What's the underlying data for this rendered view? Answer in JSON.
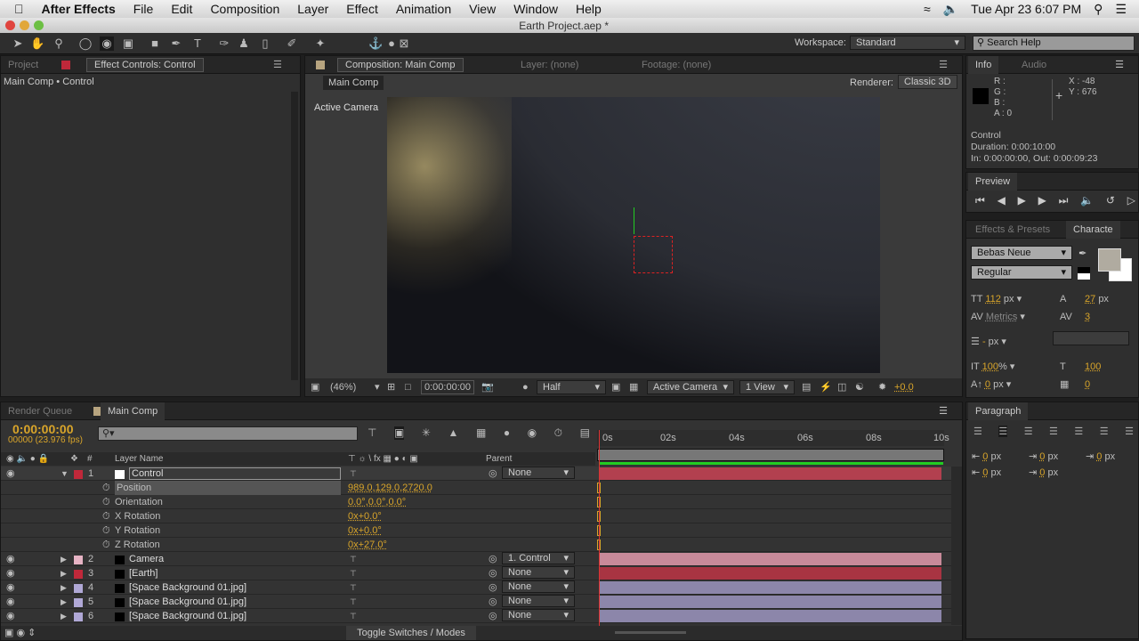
{
  "menubar": {
    "app": "After Effects",
    "items": [
      "File",
      "Edit",
      "Composition",
      "Layer",
      "Effect",
      "Animation",
      "View",
      "Window",
      "Help"
    ],
    "clock": "Tue Apr 23  6:07 PM"
  },
  "window": {
    "title": "Earth Project.aep *"
  },
  "toolbar": {
    "workspace_label": "Workspace:",
    "workspace": "Standard",
    "search_placeholder": "Search Help"
  },
  "left_panel": {
    "tabs": [
      "Project",
      "Effect Controls: Control"
    ],
    "breadcrumb": "Main Comp • Control"
  },
  "comp_panel": {
    "tabs": [
      "Composition: Main Comp",
      "Layer: (none)",
      "Footage: (none)"
    ],
    "comp_button": "Main Comp",
    "renderer_label": "Renderer:",
    "renderer": "Classic 3D",
    "camera_label": "Active Camera",
    "footer": {
      "zoom": "(46%)",
      "timecode": "0:00:00:00",
      "resolution": "Half",
      "camera": "Active Camera",
      "views": "1 View",
      "exposure": "+0.0"
    }
  },
  "info": {
    "tabs": [
      "Info",
      "Audio"
    ],
    "r": "R :",
    "g": "G :",
    "b": "B :",
    "a": "A : 0",
    "x": "X : -48",
    "y": "Y : 676",
    "layer": "Control",
    "duration": "Duration: 0:00:10:00",
    "inout": "In: 0:00:00:00, Out: 0:00:09:23"
  },
  "preview": {
    "tab": "Preview"
  },
  "character": {
    "tabs": [
      "Effects & Presets",
      "Characte"
    ],
    "font": "Bebas Neue",
    "style": "Regular",
    "size": "112",
    "size_unit": "px",
    "leading": "27",
    "leading_unit": "px",
    "kerning": "Metrics",
    "tracking": "3",
    "stroke": "-",
    "stroke_unit": "px",
    "vscale": "100",
    "hscale": "100",
    "pct": "%",
    "baseline": "0",
    "baseline_unit": "px",
    "tsume": "0"
  },
  "paragraph": {
    "tab": "Paragraph",
    "values": [
      "0",
      "0",
      "0",
      "0",
      "0"
    ],
    "unit": "px"
  },
  "timeline": {
    "tabs": [
      "Render Queue",
      "Main Comp"
    ],
    "timecode": "0:00:00:00",
    "frames": "00000 (23.976 fps)",
    "col_layer_name": "Layer Name",
    "col_num": "#",
    "col_parent": "Parent",
    "ruler": [
      "0s",
      "02s",
      "04s",
      "06s",
      "08s",
      "10s"
    ],
    "toggle_label": "Toggle Switches / Modes",
    "layers": [
      {
        "num": "1",
        "name": "Control",
        "color": "#c0283a",
        "parent": "None",
        "bar": "#b2404f"
      },
      {
        "num": "2",
        "name": "Camera",
        "color": "#e6b3c4",
        "parent": "1. Control",
        "bar": "#c88a9a"
      },
      {
        "num": "3",
        "name": "[Earth]",
        "color": "#c0283a",
        "parent": "None",
        "bar": "#a83442"
      },
      {
        "num": "4",
        "name": "[Space Background 01.jpg]",
        "color": "#b0a8d6",
        "parent": "None",
        "bar": "#8c86aa"
      },
      {
        "num": "5",
        "name": "[Space Background 01.jpg]",
        "color": "#b0a8d6",
        "parent": "None",
        "bar": "#8c86aa"
      },
      {
        "num": "6",
        "name": "[Space Background 01.jpg]",
        "color": "#b0a8d6",
        "parent": "None",
        "bar": "#8c86aa"
      }
    ],
    "properties": [
      {
        "name": "Position",
        "value": "989.0,129.0,2720.0"
      },
      {
        "name": "Orientation",
        "value": "0.0°,0.0°,0.0°"
      },
      {
        "name": "X Rotation",
        "value": "0x+0.0°"
      },
      {
        "name": "Y Rotation",
        "value": "0x+0.0°"
      },
      {
        "name": "Z Rotation",
        "value": "0x+27.0°"
      }
    ]
  }
}
